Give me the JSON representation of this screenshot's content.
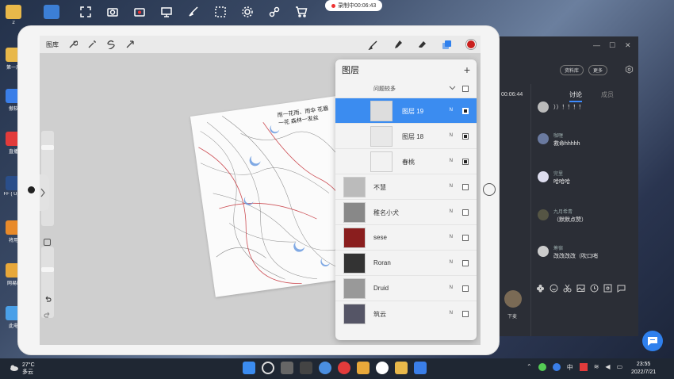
{
  "desktop": {
    "icons": [
      {
        "label": "2",
        "color": "#e8b84a"
      },
      {
        "label": "",
        "color": "#3c7fd6"
      },
      {
        "label": "第一周",
        "color": "#e8b84a"
      },
      {
        "label": "傲软",
        "color": "#3a7ee8"
      },
      {
        "label": "直播",
        "color": "#e23b3b"
      },
      {
        "label": "FF ( Uplo",
        "color": "#2a4e8a"
      },
      {
        "label": "将用",
        "color": "#e88a2a"
      },
      {
        "label": "网易P",
        "color": "#e8a83a"
      },
      {
        "label": "此电",
        "color": "#4aa0e8"
      }
    ]
  },
  "recording": {
    "label": "录制中00:06:43"
  },
  "ipad": {
    "topbar": {
      "gallery": "图库"
    },
    "artwork": {
      "text": "雨一花雨、雨伞 花眉一花 森林一发丝"
    },
    "layers_panel": {
      "title": "图层",
      "add": "+",
      "group": {
        "name": "问题较多"
      },
      "layers": [
        {
          "name": "图层 19",
          "mode": "N",
          "checked": true,
          "selected": true,
          "indent": true
        },
        {
          "name": "图层 18",
          "mode": "N",
          "checked": true,
          "selected": false,
          "indent": true
        },
        {
          "name": "春桃",
          "mode": "N",
          "checked": true,
          "selected": false,
          "indent": true
        },
        {
          "name": "不慧",
          "mode": "N",
          "checked": false,
          "selected": false,
          "indent": false
        },
        {
          "name": "稚名小犬",
          "mode": "N",
          "checked": false,
          "selected": false,
          "indent": false
        },
        {
          "name": "sese",
          "mode": "N",
          "checked": false,
          "selected": false,
          "indent": false
        },
        {
          "name": "Roran",
          "mode": "N",
          "checked": false,
          "selected": false,
          "indent": false
        },
        {
          "name": "Druid",
          "mode": "N",
          "checked": false,
          "selected": false,
          "indent": false
        },
        {
          "name": "筑云",
          "mode": "N",
          "checked": false,
          "selected": false,
          "indent": false
        }
      ]
    },
    "colors": {
      "current_color": "#c9201e",
      "selected_layer": "#3b8cf0"
    }
  },
  "chat": {
    "buttons": [
      "资料库",
      "更多"
    ],
    "time": "00:06:44",
    "tabs": [
      "讨论",
      "成员"
    ],
    "messages": [
      {
        "name": "",
        "text": "））！！！！"
      },
      {
        "name": "咖喱",
        "text": "救命hhhhh"
      },
      {
        "name": "完里",
        "text": "哈哈哈"
      },
      {
        "name": "九月希青",
        "text": "（默默点赞）"
      },
      {
        "name": "筹宿",
        "text": "改改改改（吹口哨"
      }
    ],
    "leave_label": "下麦"
  },
  "taskbar": {
    "temp": "27°C",
    "weather": "多云",
    "ime": "中",
    "time": "23:55",
    "date": "2022/7/21"
  }
}
